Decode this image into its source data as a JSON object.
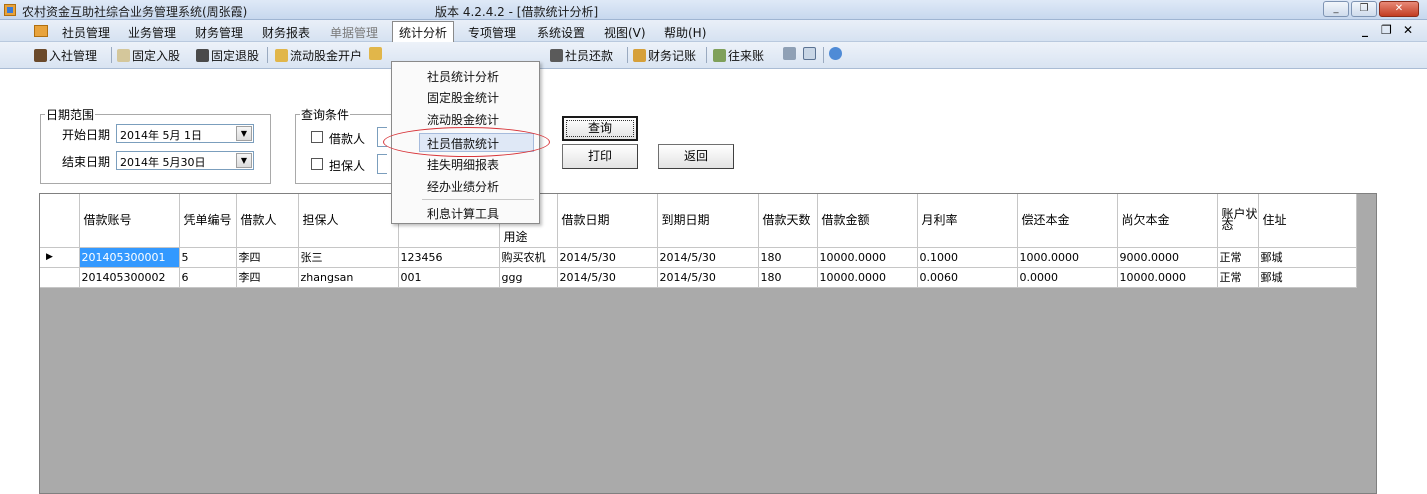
{
  "window": {
    "title": "农村资金互助社综合业务管理系统(周张霞)",
    "version": "版本 4.2.4.2 - [借款统计分析]",
    "buttons": {
      "minimize": "_",
      "restore": "❐",
      "close": "✕"
    }
  },
  "menubar": {
    "items": [
      "社员管理",
      "业务管理",
      "财务管理",
      "财务报表",
      "单据管理",
      "统计分析",
      "专项管理",
      "系统设置",
      "视图(V)",
      "帮助(H)"
    ],
    "mdi_controls": {
      "minimize": "_",
      "restore": "❐",
      "close": "✕"
    }
  },
  "toolbar": {
    "items": [
      "入社管理",
      "固定入股",
      "固定退股",
      "流动股金开户",
      "社员还款",
      "财务记账",
      "往来账"
    ]
  },
  "dropdown": {
    "items": [
      "社员统计分析",
      "固定股金统计",
      "流动股金统计",
      "社员借款统计",
      "挂失明细报表",
      "经办业绩分析",
      "利息计算工具"
    ],
    "highlighted_index": 3
  },
  "date_range": {
    "legend": "日期范围",
    "start_label": "开始日期",
    "start_value": "2014年 5月 1日",
    "end_label": "结束日期",
    "end_value": "2014年 5月30日"
  },
  "query": {
    "legend": "查询条件",
    "borrower_label": "借款人",
    "guarantor_label": "担保人"
  },
  "buttons": {
    "query": "查询",
    "print": "打印",
    "back": "返回"
  },
  "grid": {
    "columns": [
      "借款账号",
      "凭单编号",
      "借款人",
      "担保人",
      "",
      "用途",
      "借款日期",
      "到期日期",
      "借款天数",
      "借款金额",
      "月利率",
      "偿还本金",
      "尚欠本金",
      "账户状态",
      "住址"
    ],
    "rows": [
      [
        "201405300001",
        "5",
        "李四",
        "张三",
        "123456",
        "购买农机",
        "2014/5/30",
        "2014/5/30",
        "180",
        "10000.0000",
        "0.1000",
        "1000.0000",
        "9000.0000",
        "正常",
        "鄄城"
      ],
      [
        "201405300002",
        "6",
        "李四",
        "zhangsan",
        "001",
        "ggg",
        "2014/5/30",
        "2014/5/30",
        "180",
        "10000.0000",
        "0.0060",
        "0.0000",
        "10000.0000",
        "正常",
        "鄄城"
      ]
    ]
  },
  "colors": {
    "selection": "#3399ff",
    "grid_background": "#aaaaaa",
    "annotation_oval": "#d8363b"
  }
}
